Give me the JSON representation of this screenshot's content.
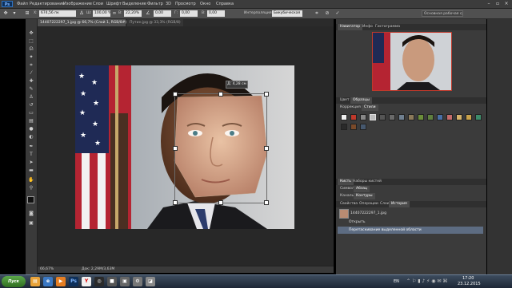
{
  "menubar": {
    "items": [
      "Файл",
      "Редактирование",
      "Изображение",
      "Слои",
      "Шрифт",
      "Выделение",
      "Фильтр",
      "3D",
      "Просмотр",
      "Окно",
      "Справка"
    ],
    "logo": "Ps"
  },
  "options": {
    "x": "674,56 пк",
    "w": "100,00 %",
    "h": "22,20%",
    "rot": "0,00",
    "hskew": "0,00",
    "vskew": "0,00",
    "interp_label": "Интерполяция:",
    "interp_value": "Бикубическая",
    "workspace": "Основная рабочая среда"
  },
  "tabs": {
    "doc1": "14407222297_1.jpg @ 66,7% (Слой 1, RGB/8#) *",
    "doc2": "Путин.jpg @ 33,3% (RGB/8)"
  },
  "canvas": {
    "tooltip": "Д: 4,28 см"
  },
  "status": {
    "zoom": "66,67%",
    "doc": "Док: 2,29М/3,63М"
  },
  "panels": {
    "top_tabs": [
      "Навигатор",
      "Инфо",
      "Гистограмма"
    ],
    "mid_tabs": [
      "Цвет",
      "Образцы"
    ],
    "style_tabs": [
      "Коррекция",
      "Стили"
    ],
    "layer_tabs": [
      "Кисть",
      "Наборы кистей"
    ],
    "layer_tabs2": [
      "Символ",
      "Абзац"
    ],
    "layer_tabs3": [
      "Каналы",
      "Контуры"
    ],
    "history_tabs": [
      "Свойства",
      "Операции",
      "Слои",
      "История"
    ],
    "history": [
      "14407222297_1.jpg",
      "Открыть",
      "Перетаскивание выделенной области"
    ]
  },
  "taskbar": {
    "start": "Пуск",
    "lang": "EN",
    "time": "17:20",
    "date": "23.12.2015"
  },
  "colors": {
    "accent_blue": "#2f73c0",
    "selected_history": "#5d6c82",
    "workspace_bg": "#282828"
  }
}
